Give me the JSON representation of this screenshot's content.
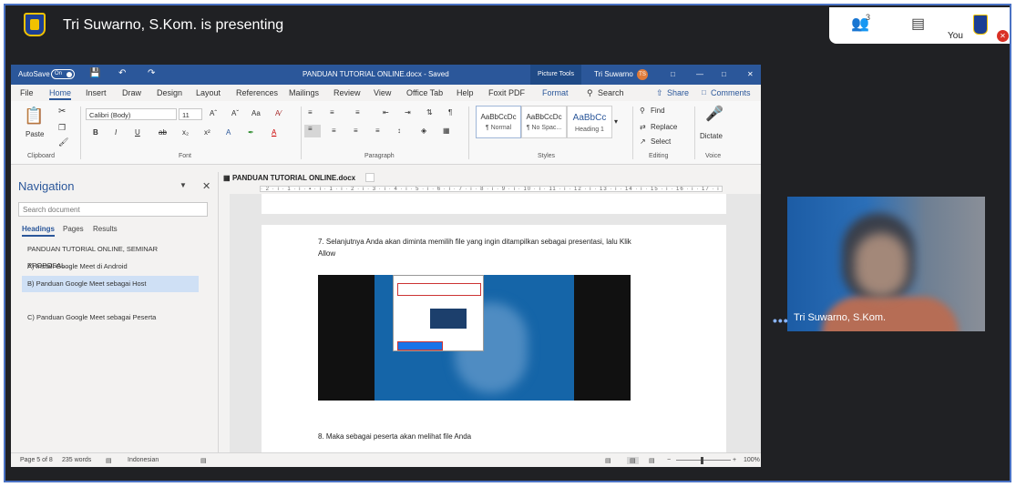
{
  "meet": {
    "presenting_text": "Tri Suwarno, S.Kom. is presenting",
    "participants_count": "3",
    "you_label": "You",
    "participant_name": "Tri Suwarno, S.Kom."
  },
  "word": {
    "autosave_label": "AutoSave",
    "autosave_state": "On",
    "doc_title": "PANDUAN TUTORIAL ONLINE.docx - Saved",
    "picture_tools": "Picture Tools",
    "user_name": "Tri Suwarno",
    "user_initials": "TS",
    "menu": [
      "File",
      "Home",
      "Insert",
      "Draw",
      "Design",
      "Layout",
      "References",
      "Mailings",
      "Review",
      "View",
      "Office Tab",
      "Help",
      "Foxit PDF",
      "Format"
    ],
    "search_label": "Search",
    "share_label": "Share",
    "comments_label": "Comments",
    "ribbon": {
      "paste": "Paste",
      "clipboard": "Clipboard",
      "font_name": "Calibri (Body)",
      "font_size": "11",
      "font": "Font",
      "paragraph": "Paragraph",
      "styles": "Styles",
      "style_preview": "AaBbCcDc",
      "style_preview_heading": "AaBbCc",
      "style_normal": "¶ Normal",
      "style_nospace": "¶ No Spac...",
      "style_heading1": "Heading 1",
      "find": "Find",
      "replace": "Replace",
      "select": "Select",
      "editing": "Editing",
      "dictate": "Dictate",
      "voice": "Voice"
    },
    "nav": {
      "title": "Navigation",
      "search_placeholder": "Search document",
      "tabs": [
        "Headings",
        "Pages",
        "Results"
      ],
      "items": [
        "PANDUAN TUTORIAL ONLINE, SEMINAR PROPOSAL...",
        "A) Install Google Meet di Android",
        "B) Panduan Google Meet sebagai Host",
        "C) Panduan Google Meet sebagai Peserta"
      ]
    },
    "doc_tab": "PANDUAN TUTORIAL ONLINE.docx",
    "ruler": "· 2 · ı · 1 · ı · ▪ · ı · 1 · ı · 2 · ı · 3 · ı · 4 · ı · 5 · ı · 6 · ı · 7 · ı · 8 · ı · 9 · ı · 10 · ı · 11 · ı · 12 · ı · 13 · ı · 14 · ı · 15 · ı · 16 · ı · 17 · ı · 18",
    "para7": "7. Selanjutnya Anda akan diminta memilih file yang ingin ditampilkan sebagai presentasi, lalu Klik Allow",
    "para8": "8. Maka sebagai peserta akan melihat file Anda",
    "status": {
      "page": "Page 5 of 8",
      "words": "235 words",
      "language": "Indonesian",
      "zoom": "100%"
    }
  }
}
